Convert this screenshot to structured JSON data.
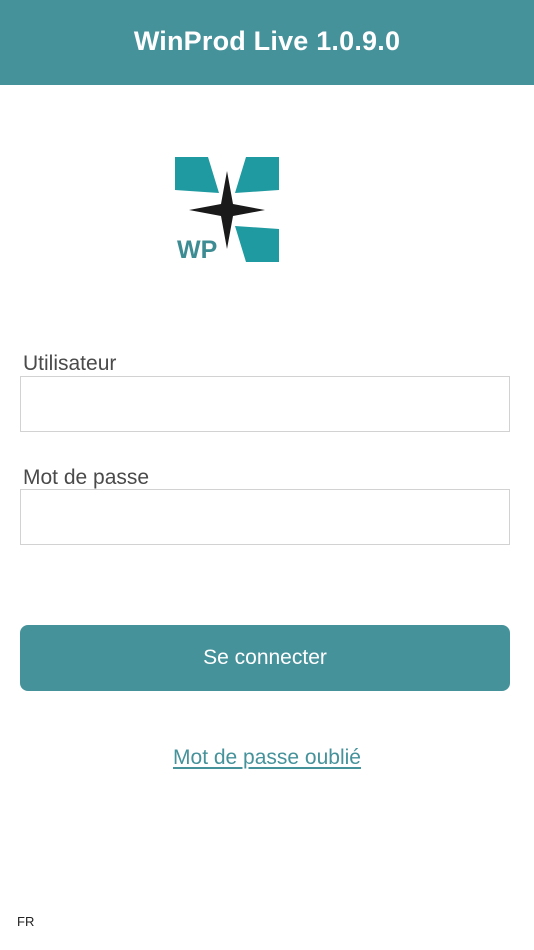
{
  "header": {
    "title": "WinProd Live 1.0.9.0"
  },
  "logo": {
    "text": "WP",
    "icon": "compass-star-logo"
  },
  "form": {
    "username_label": "Utilisateur",
    "username_value": "",
    "password_label": "Mot de passe",
    "password_value": "",
    "submit_label": "Se connecter"
  },
  "forgot_password_label": "Mot de passe oublié",
  "language_label": "FR",
  "colors": {
    "accent": "#46929B",
    "logo_teal": "#1E9AA0",
    "logo_star": "#1A1A1A"
  }
}
